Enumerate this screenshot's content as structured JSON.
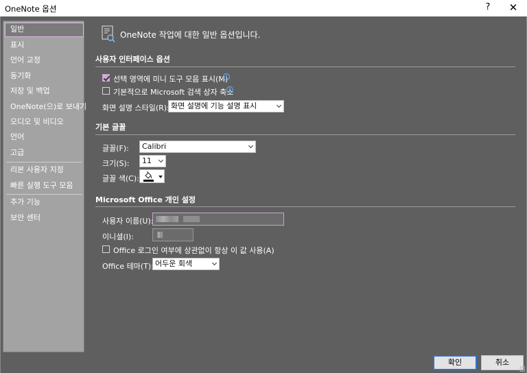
{
  "window": {
    "title": "OneNote 옵션",
    "help_glyph": "?",
    "close_glyph": "✕"
  },
  "sidebar": {
    "items": [
      {
        "label": "일반"
      },
      {
        "label": "표시"
      },
      {
        "label": "언어 교정"
      },
      {
        "label": "동기화"
      },
      {
        "label": "저장 및 백업"
      },
      {
        "label": "OneNote(으)로 보내기"
      },
      {
        "label": "오디오 및 비디오"
      },
      {
        "label": "언어"
      },
      {
        "label": "고급"
      },
      {
        "label": "리본 사용자 지정"
      },
      {
        "label": "빠른 실행 도구 모음"
      },
      {
        "label": "추가 기능"
      },
      {
        "label": "보안 센터"
      }
    ],
    "selected_index": 0
  },
  "header": {
    "text": "OneNote 작업에 대한 일반 옵션입니다.",
    "icon": "options-page-icon"
  },
  "ui_options": {
    "section_title": "사용자 인터페이스 옵션",
    "mini_toolbar_label": "선택 영역에 미니 도구 모음 표시(M)",
    "mini_toolbar_checked": true,
    "collapse_search_label": "기본적으로 Microsoft 검색 상자 축소",
    "collapse_search_checked": false,
    "screentip_label": "화면 설명 스타일(R):",
    "screentip_value": "화면 설명에 기능 설명 표시",
    "info_glyph": "i"
  },
  "default_font": {
    "section_title": "기본 글꼴",
    "font_label": "글꼴(F):",
    "font_value": "Calibri",
    "size_label": "크기(S):",
    "size_value": "11",
    "color_label": "글꼴 색(C):",
    "color_value": "#000000"
  },
  "personalize": {
    "section_title": "Microsoft Office 개인 설정",
    "username_label": "사용자 이름(U):",
    "initials_label": "이니셜(I):",
    "always_use_label": "Office 로그인 여부에 상관없이 항상 이 값 사용(A)",
    "always_use_checked": false,
    "theme_label": "Office 테마(T):",
    "theme_value": "어두운 회색"
  },
  "footer": {
    "ok_label": "확인",
    "cancel_label": "취소"
  },
  "colors": {
    "background": "#5f5f5f",
    "sidebar": "#a3a3a3",
    "accent": "#d9a7e0",
    "info": "#5fb2ff",
    "primary_border": "#2f6fd0"
  }
}
